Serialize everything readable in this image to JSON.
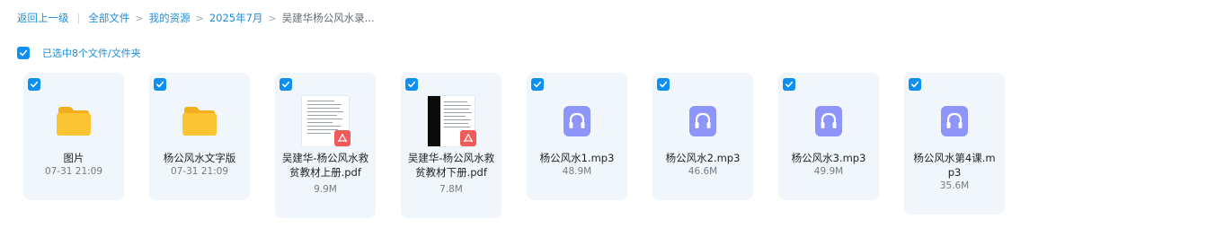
{
  "breadcrumb": {
    "back": "返回上一级",
    "separator": "|",
    "arrow": ">",
    "items": [
      "全部文件",
      "我的资源",
      "2025年7月",
      "吴建华杨公风水录..."
    ]
  },
  "selection": {
    "label": "已选中8个文件/文件夹",
    "checked": true
  },
  "colors": {
    "accent": "#0d90f2",
    "link": "#1f8cd8",
    "card_bg": "#f0f6fc",
    "folder": "#fcc431",
    "audio": "#8e95f8",
    "pdf": "#f05a58"
  },
  "files": [
    {
      "name": "图片",
      "meta": "07-31 21:09",
      "icon": "folder-icon",
      "selected": true
    },
    {
      "name": "杨公风水文字版",
      "meta": "07-31 21:09",
      "icon": "folder-icon",
      "selected": true
    },
    {
      "name": "吴建华-杨公风水救贫教材上册.pdf",
      "meta": "9.9M",
      "icon": "pdf-thumbnail-icon",
      "selected": true
    },
    {
      "name": "吴建华-杨公风水救贫教材下册.pdf",
      "meta": "7.8M",
      "icon": "pdf-thumbnail-icon",
      "selected": true
    },
    {
      "name": "杨公风水1.mp3",
      "meta": "48.9M",
      "icon": "audio-headphones-icon",
      "selected": true
    },
    {
      "name": "杨公风水2.mp3",
      "meta": "46.6M",
      "icon": "audio-headphones-icon",
      "selected": true
    },
    {
      "name": "杨公风水3.mp3",
      "meta": "49.9M",
      "icon": "audio-headphones-icon",
      "selected": true
    },
    {
      "name": "杨公风水第4课.mp3",
      "meta": "35.6M",
      "icon": "audio-headphones-icon",
      "selected": true
    }
  ]
}
